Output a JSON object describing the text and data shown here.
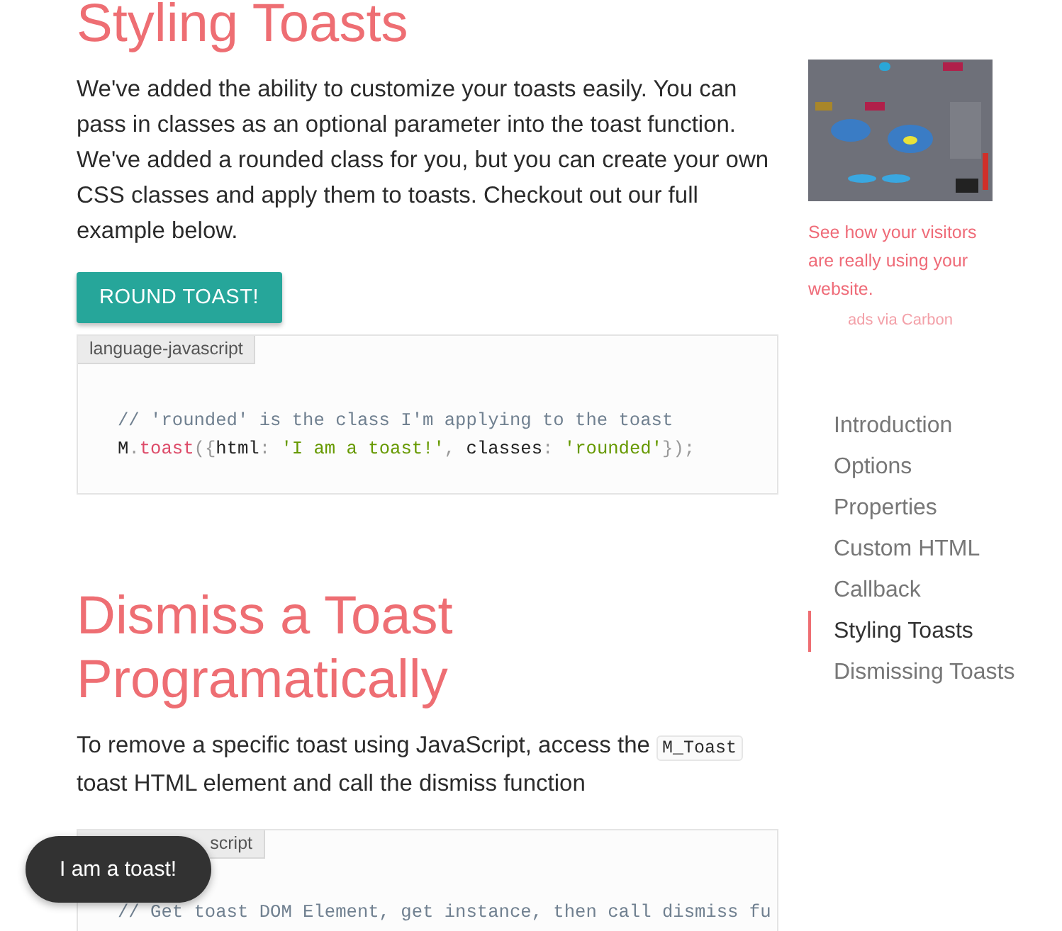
{
  "sections": [
    {
      "heading": "Styling Toasts",
      "paragraph": "We've added the ability to customize your toasts easily. You can pass in classes as an optional parameter into the toast function. We've added a rounded class for you, but you can create your own CSS classes and apply them to toasts. Checkout out our full example below.",
      "button": "ROUND TOAST!",
      "code": {
        "label": "language-javascript",
        "lines": [
          [
            {
              "kind": "comment",
              "text": "// 'rounded' is the class I'm applying to the toast"
            }
          ],
          [
            {
              "kind": "plain",
              "text": "M"
            },
            {
              "kind": "punct",
              "text": "."
            },
            {
              "kind": "func",
              "text": "toast"
            },
            {
              "kind": "punct",
              "text": "({"
            },
            {
              "kind": "plain",
              "text": "html"
            },
            {
              "kind": "punct",
              "text": ": "
            },
            {
              "kind": "string",
              "text": "'I am a toast!'"
            },
            {
              "kind": "punct",
              "text": ", "
            },
            {
              "kind": "plain",
              "text": "classes"
            },
            {
              "kind": "punct",
              "text": ": "
            },
            {
              "kind": "string",
              "text": "'rounded'"
            },
            {
              "kind": "punct",
              "text": "});"
            }
          ]
        ]
      }
    },
    {
      "heading": "Dismiss a Toast Programatically",
      "paragraph_parts": [
        {
          "kind": "text",
          "text": "To remove a specific toast using JavaScript, access the "
        },
        {
          "kind": "code",
          "text": "M_Toast"
        },
        {
          "kind": "text",
          "text": " toast HTML element and call the dismiss function"
        }
      ],
      "code": {
        "label": "script",
        "lines": [
          [
            {
              "kind": "comment",
              "text": "// Get toast DOM Element, get instance, then call dismiss fu"
            }
          ]
        ]
      }
    }
  ],
  "ad": {
    "kind": "picture",
    "text": "See how your visitors are really using your website.",
    "credit": "ads via Carbon"
  },
  "toc": [
    {
      "label": "Introduction",
      "selected": false
    },
    {
      "label": "Options",
      "selected": false
    },
    {
      "label": "Properties",
      "selected": false
    },
    {
      "label": "Custom HTML",
      "selected": false
    },
    {
      "label": "Callback",
      "selected": false
    },
    {
      "label": "Styling Toasts",
      "selected": true
    },
    {
      "label": "Dismissing Toasts",
      "selected": false
    }
  ],
  "toast": {
    "text": "I am a toast!"
  }
}
